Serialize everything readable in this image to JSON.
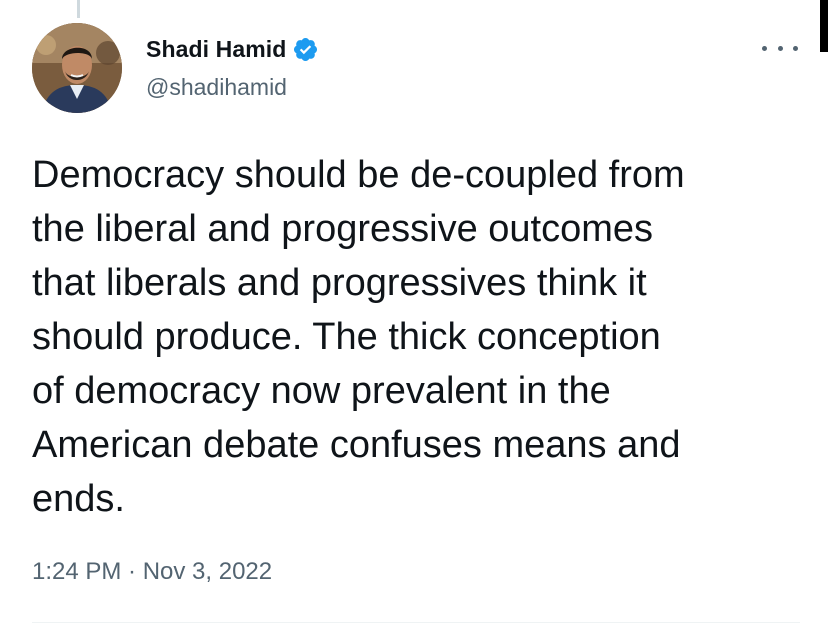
{
  "author": {
    "display_name": "Shadi Hamid",
    "handle": "@shadihamid",
    "verified": true,
    "avatar_icon": "avatar-photo"
  },
  "more_menu": {
    "icon": "more-horizontal-icon"
  },
  "tweet": {
    "text": "Democracy should be de-coupled from\nthe liberal and progressive outcomes\nthat liberals and progressives think it\nshould produce. The thick conception\nof democracy now prevalent in the\nAmerican debate confuses means and\nends.",
    "timestamp": "1:24 PM · Nov 3, 2022"
  },
  "colors": {
    "text_primary": "#0f1419",
    "text_secondary": "#536471",
    "verified_blue": "#1d9bf0",
    "divider": "#eff3f4"
  }
}
